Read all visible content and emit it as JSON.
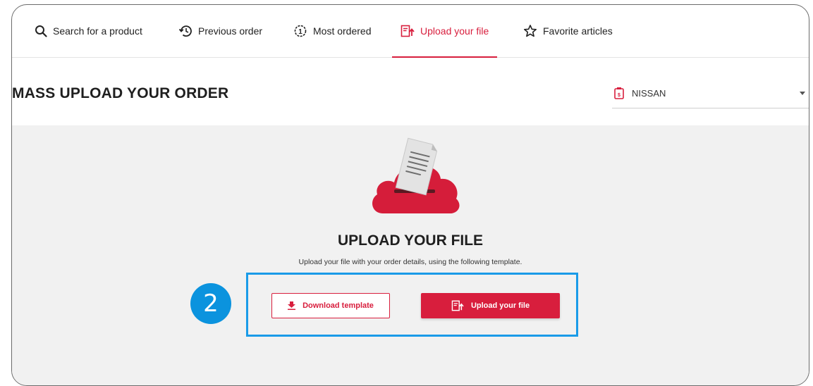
{
  "tabs": [
    {
      "label": "Search for a product",
      "icon": "search-icon"
    },
    {
      "label": "Previous order",
      "icon": "history-icon"
    },
    {
      "label": "Most ordered",
      "icon": "badge-one-icon"
    },
    {
      "label": "Upload your file",
      "icon": "file-upload-icon",
      "active": true
    },
    {
      "label": "Favorite articles",
      "icon": "star-icon"
    }
  ],
  "page": {
    "title": "MASS UPLOAD YOUR ORDER"
  },
  "brand_select": {
    "value": "NISSAN",
    "icon": "brand-tag-icon"
  },
  "upload": {
    "title": "UPLOAD YOUR FILE",
    "description": "Upload your file with your order details, using the following template.",
    "download_label": "Download template",
    "upload_label": "Upload your file"
  },
  "annotation": {
    "step_number": "2"
  },
  "colors": {
    "accent": "#d81e3d",
    "highlight": "#1a9be8",
    "badge": "#0b93de",
    "area_bg": "#f1f1f1"
  }
}
